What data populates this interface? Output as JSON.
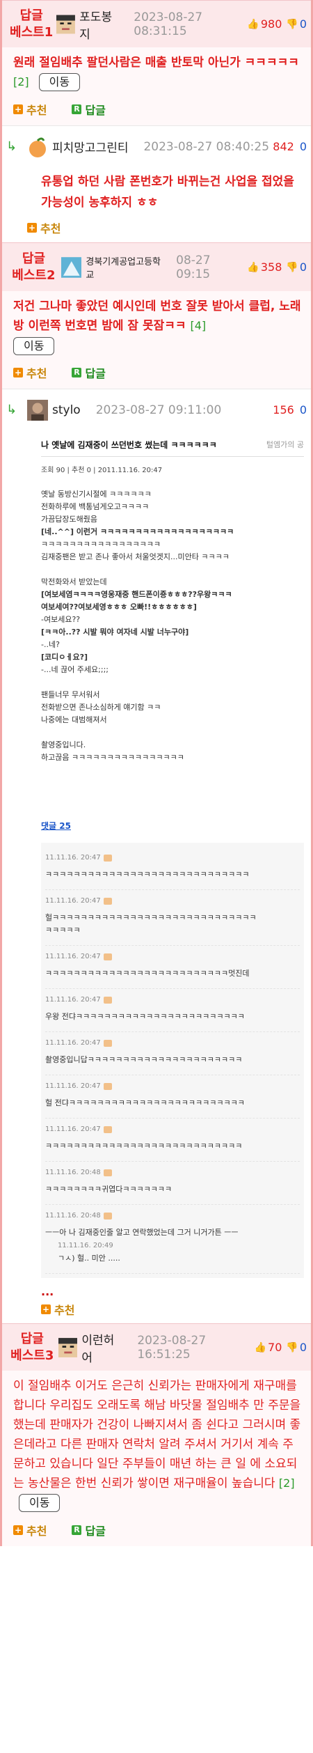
{
  "best1": {
    "tag_line1": "답글",
    "tag_line2": "베스트1",
    "nick": "포도봉지",
    "time": "2023-08-27 08:31:15",
    "up": "980",
    "down": "0",
    "text": "원래 절임배추 팔던사람은 매출 반토막 아닌가 ㅋㅋㅋㅋㅋ",
    "reply_count": "[2]",
    "move_label": "이동",
    "recommend_label": "추천",
    "reply_label": "답글"
  },
  "reply1": {
    "nick": "피치망고그린티",
    "time": "2023-08-27 08:40:25",
    "up": "842",
    "down": "0",
    "text": "유통업 하던 사람 폰번호가 바뀌는건 사업을 접었을 가능성이 농후하지 ㅎㅎ",
    "recommend_label": "추천"
  },
  "best2": {
    "tag_line1": "답글",
    "tag_line2": "베스트2",
    "nick": "경북기계공업고등학교",
    "time": "08-27 09:15",
    "up": "358",
    "down": "0",
    "text": "저건 그나마 좋았던 예시인데 번호 잘못 받아서 클럽, 노래방 이런쪽 번호면 밤에 잠 못잠ㅋㅋ",
    "reply_count": "[4]",
    "move_label": "이동",
    "recommend_label": "추천",
    "reply_label": "답글"
  },
  "reply2": {
    "nick": "stylo",
    "time": "2023-08-27 09:11:00",
    "up": "156",
    "down": "0",
    "embed": {
      "title": "나 옛날에 김재중이 쓰던번호 썼는데 ㅋㅋㅋㅋㅋㅋ",
      "author": "털엠가의 공",
      "meta": "조회 90  |  추천 0  |  2011.11.16. 20:47",
      "lines": [
        "옛날 동방신기시절에 ㅋㅋㅋㅋㅋㅋ",
        "전화하루에 백통넘게오고ㅋㅋㅋㅋ",
        "가끔답장도해줬음",
        "[네..^^] 이런거 ㅋㅋㅋㅋㅋㅋㅋㅋㅋㅋㅋㅋㅋㅋㅋㅋㅋㅋㅋ",
        "ㅋㅋㅋㅋㅋㅋㅋㅋㅋㅋㅋㅋㅋㅋㅋㅋㅋ",
        "김재중팬은 받고 존나 좋아서 처울엇겟지...미안타 ㅋㅋㅋㅋ",
        "",
        "막전화와서 받았는데",
        "[여보세염ㅋㅋㅋㅋ영웅재중 핸드폰이죵ㅎㅎㅎ??우왕ㅋㅋㅋ",
        "여보세여??여보세영ㅎㅎㅎ 오빠!!ㅎㅎㅎㅎㅎㅎ]",
        "-여보세요??",
        "[ㅋㅋ아..?? 시발 뭐야 여자네 시발 너누구야]",
        "-..네?",
        "[코디ㅇㅔ요?]",
        "-...네 끊어 주세요;;;;",
        "",
        "팬들너무 무서워서",
        "전화받으면 존나소심하게 얘기함 ㅋㅋ",
        "나중에는 대범해져서",
        "",
        "촬영중입니다.",
        "하고끊음 ㅋㅋㅋㅋㅋㅋㅋㅋㅋㅋㅋㅋㅋㅋㅋㅋ"
      ],
      "comment_count": "댓글 25",
      "comments": [
        {
          "time": "11.11.16. 20:47",
          "text": "ㅋㅋㅋㅋㅋㅋㅋㅋㅋㅋㅋㅋㅋㅋㅋㅋㅋㅋㅋㅋㅋㅋㅋㅋㅋㅋㅋㅋㅋ"
        },
        {
          "time": "11.11.16. 20:47",
          "text": "헐ㅋㅋㅋㅋㅋㅋㅋㅋㅋㅋㅋㅋㅋㅋㅋㅋㅋㅋㅋㅋㅋㅋㅋㅋㅋㅋㅋㅋㅋ",
          "text2": "ㅋㅋㅋㅋㅋ"
        },
        {
          "time": "11.11.16. 20:47",
          "text": "ㅋㅋㅋㅋㅋㅋㅋㅋㅋㅋㅋㅋㅋㅋㅋㅋㅋㅋㅋㅋㅋㅋㅋㅋㅋㅋ멋진데"
        },
        {
          "time": "11.11.16. 20:47",
          "text": "우왕 전댜ㅋㅋㅋㅋㅋㅋㅋㅋㅋㅋㅋㅋㅋㅋㅋㅋㅋㅋㅋㅋㅋㅋㅋㅋ"
        },
        {
          "time": "11.11.16. 20:47",
          "text": "촬영중입니답ㅋㅋㅋㅋㅋㅋㅋㅋㅋㅋㅋㅋㅋㅋㅋㅋㅋㅋㅋㅋㅋㅋ"
        },
        {
          "time": "11.11.16. 20:47",
          "text": "헐 전댜ㅋㅋㅋㅋㅋㅋㅋㅋㅋㅋㅋㅋㅋㅋㅋㅋㅋㅋㅋㅋㅋㅋㅋㅋㅋ"
        },
        {
          "time": "11.11.16. 20:47",
          "text": "ㅋㅋㅋㅋㅋㅋㅋㅋㅋㅋㅋㅋㅋㅋㅋㅋㅋㅋㅋㅋㅋㅋㅋㅋㅋㅋㅋㅋ"
        },
        {
          "time": "11.11.16. 20:48",
          "text": "ㅋㅋㅋㅋㅋㅋㅋㅋ귀엽다ㅋㅋㅋㅋㅋㅋㅋ"
        },
        {
          "time": "11.11.16. 20:48",
          "text": "ㅡㅡ아 나 김재중인줄 알고 연락했었는데 그거 니거가튼 ㅡㅡ",
          "sub_time": "11.11.16. 20:49",
          "sub_text": "ㄱㅅ) 헐.. 미안 ....."
        }
      ]
    },
    "ellipsis": "...",
    "recommend_label": "추천"
  },
  "best3": {
    "tag_line1": "답글",
    "tag_line2": "베스트3",
    "nick": "이런허어",
    "time": "2023-08-27 16:51:25",
    "up": "70",
    "down": "0",
    "text": "이 절임배추 이거도 은근히 신뢰가는 판매자에게 재구매를 합니다 우리집도 오래도록 해남 바닷물 절임배추 만 주문을 했는데 판매자가 건강이 나빠지셔서 좀 쉰다고 그러시며 좋은데라고 다른 판매자 연락처 알려 주셔서 거기서 계속 주문하고 있습니다 일단 주부들이 매년 하는 큰 일 에 소요되는 농산물은 한번 신뢰가 쌓이면 재구매율이 높습니다",
    "reply_count": "[2]",
    "move_label": "이동",
    "recommend_label": "추천",
    "reply_label": "답글"
  }
}
